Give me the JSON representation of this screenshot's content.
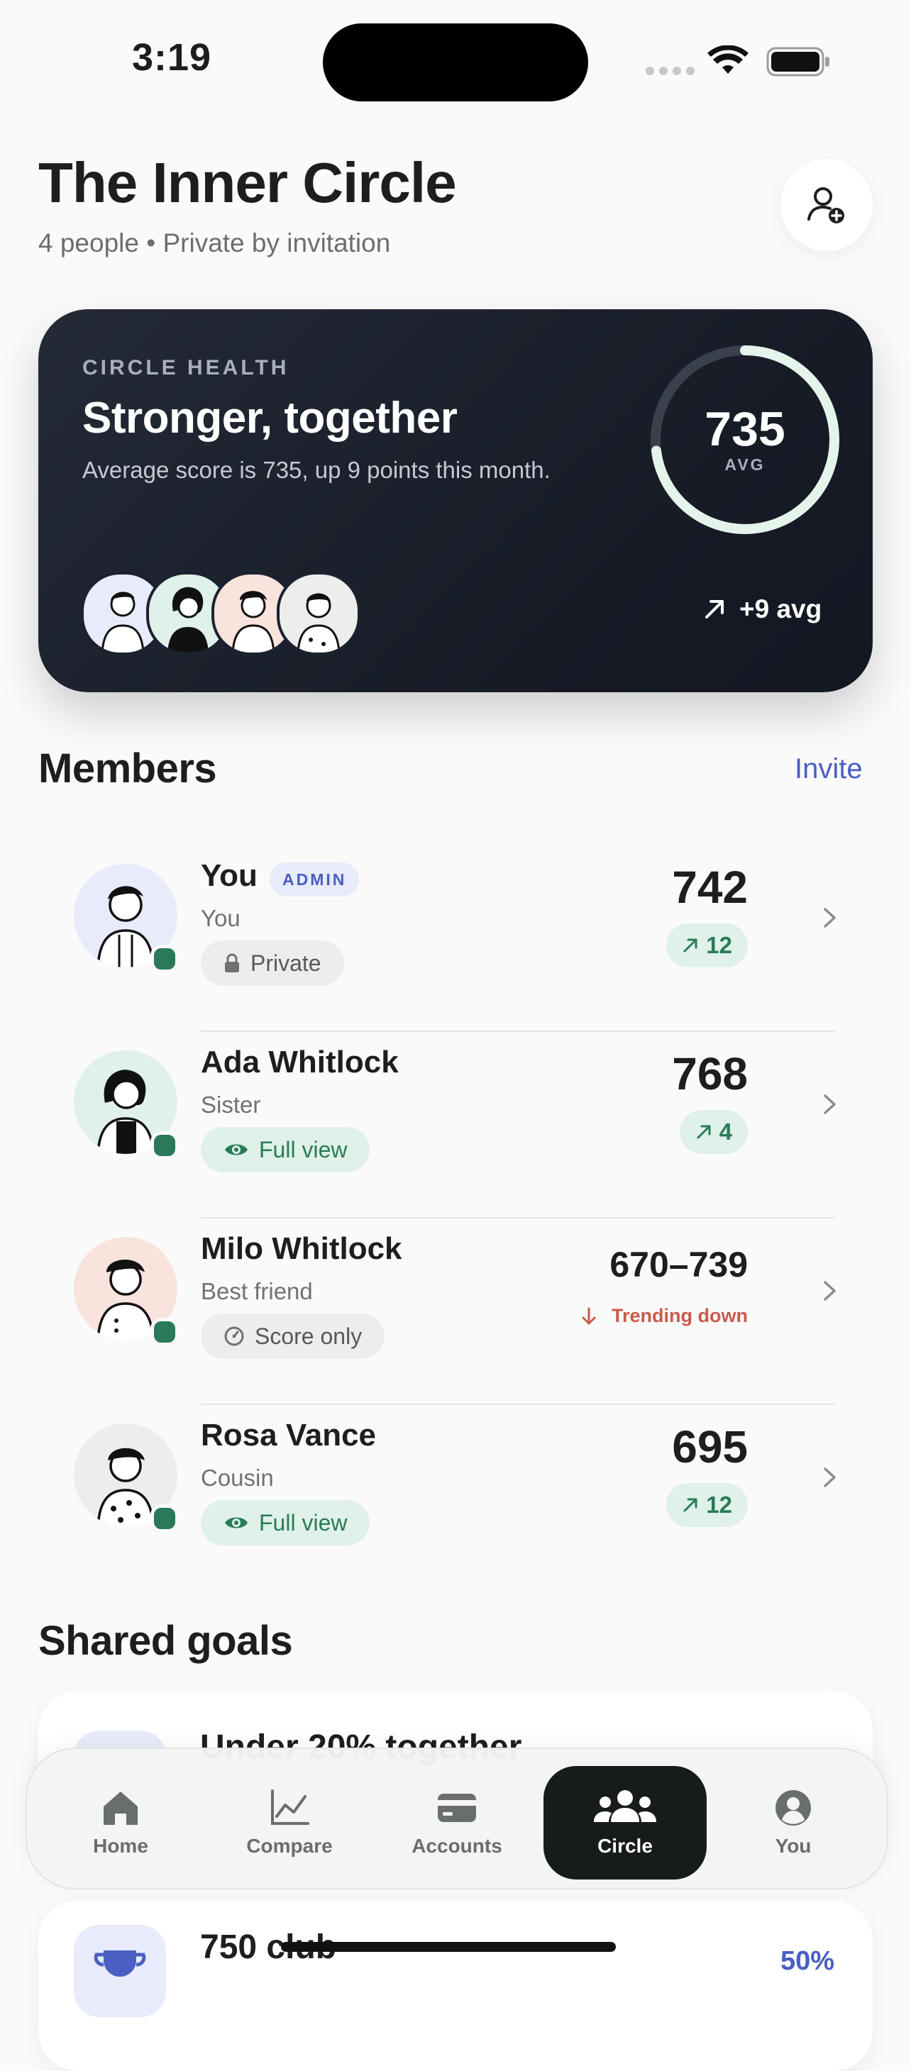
{
  "status_bar": {
    "time": "3:19"
  },
  "header": {
    "title": "The Inner Circle",
    "subtitle": "4 people • Private by invitation"
  },
  "health_card": {
    "eyebrow": "CIRCLE HEALTH",
    "title": "Stronger, together",
    "description": "Average score is 735, up 9 points this month.",
    "ring_value": "735",
    "ring_label": "AVG",
    "ring_progress": 0.73,
    "trend": "+9 avg"
  },
  "members_section": {
    "title": "Members",
    "invite_label": "Invite",
    "members": [
      {
        "name": "You",
        "badge": "ADMIN",
        "relation": "You",
        "visibility": "Private",
        "visibility_icon": "lock-icon",
        "score": "742",
        "delta": "12",
        "trend": "up",
        "avatar_bg": "#e8ebfb"
      },
      {
        "name": "Ada Whitlock",
        "relation": "Sister",
        "visibility": "Full view",
        "visibility_icon": "eye-icon",
        "score": "768",
        "delta": "4",
        "trend": "up",
        "avatar_bg": "#dff1e8"
      },
      {
        "name": "Milo Whitlock",
        "relation": "Best friend",
        "visibility": "Score only",
        "visibility_icon": "gauge-icon",
        "score": "670–739",
        "trend_text": "Trending down",
        "trend": "down",
        "avatar_bg": "#f9e3dd"
      },
      {
        "name": "Rosa Vance",
        "relation": "Cousin",
        "visibility": "Full view",
        "visibility_icon": "eye-icon",
        "score": "695",
        "delta": "12",
        "trend": "up",
        "avatar_bg": "#ededeb"
      }
    ]
  },
  "goals_section": {
    "title": "Shared goals",
    "goals": [
      {
        "title": "Under 20% together"
      },
      {
        "title": "750 club",
        "progress": "50%"
      }
    ]
  },
  "tab_bar": {
    "tabs": [
      {
        "label": "Home",
        "icon": "home-icon"
      },
      {
        "label": "Compare",
        "icon": "chart-icon"
      },
      {
        "label": "Accounts",
        "icon": "card-icon"
      },
      {
        "label": "Circle",
        "icon": "people-icon",
        "active": true
      },
      {
        "label": "You",
        "icon": "profile-icon"
      }
    ]
  },
  "colors": {
    "accent": "#4a5fc1",
    "positive": "#2a7a59",
    "negative": "#cc5a4a",
    "card_dark": "#161b26"
  }
}
